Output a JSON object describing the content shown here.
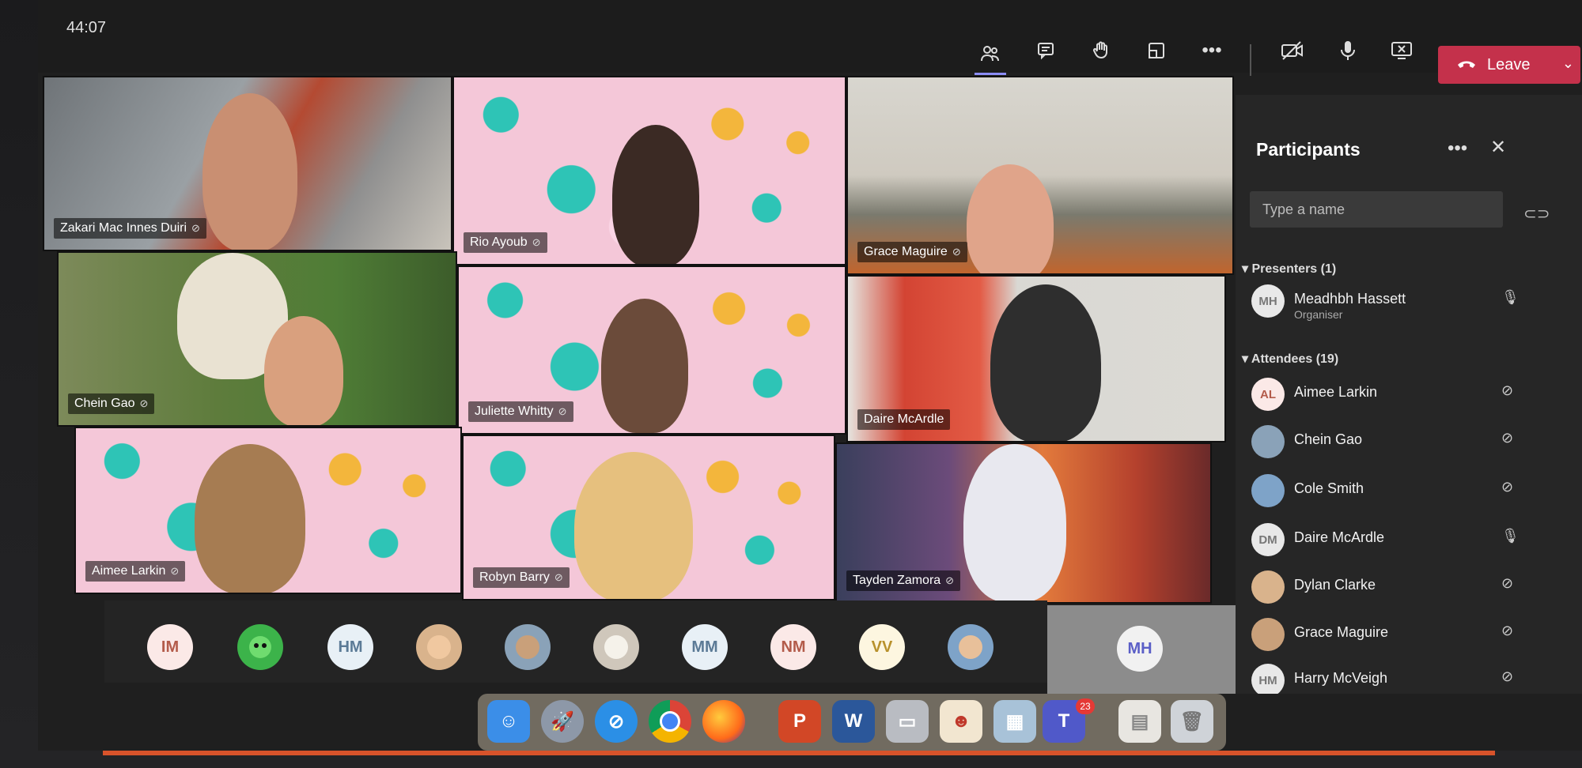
{
  "meeting": {
    "timer": "44:07",
    "leave_label": "Leave"
  },
  "toolbar_icons": [
    "participants-icon",
    "chat-icon",
    "raise-hand-icon",
    "rooms-icon",
    "more-icon",
    "camera-off-icon",
    "mic-icon",
    "share-stop-icon"
  ],
  "video_tiles": [
    {
      "name": "Zakari Mac Innes Duiri"
    },
    {
      "name": "Rio Ayoub"
    },
    {
      "name": "Grace Maguire"
    },
    {
      "name": "Chein Gao"
    },
    {
      "name": "Juliette Whitty"
    },
    {
      "name": "Daire McArdle"
    },
    {
      "name": "Aimee Larkin"
    },
    {
      "name": "Robyn Barry"
    },
    {
      "name": "Tayden Zamora"
    }
  ],
  "strip_avatars": [
    "IM",
    "",
    "HM",
    "",
    "",
    "",
    "MM",
    "NM",
    "VV",
    "",
    "MH"
  ],
  "panel": {
    "title": "Participants",
    "search_placeholder": "Type a name",
    "presenters_label": "Presenters (1)",
    "attendees_label": "Attendees (19)",
    "presenters": [
      {
        "initials": "MH",
        "name": "Meadhbh Hassett",
        "role": "Organiser"
      }
    ],
    "attendees": [
      {
        "initials": "AL",
        "name": "Aimee Larkin"
      },
      {
        "initials": "",
        "name": "Chein Gao"
      },
      {
        "initials": "",
        "name": "Cole Smith"
      },
      {
        "initials": "DM",
        "name": "Daire McArdle"
      },
      {
        "initials": "",
        "name": "Dylan Clarke"
      },
      {
        "initials": "",
        "name": "Grace Maguire"
      },
      {
        "initials": "HM",
        "name": "Harry McVeigh"
      }
    ]
  },
  "dock": {
    "badge": "23"
  }
}
